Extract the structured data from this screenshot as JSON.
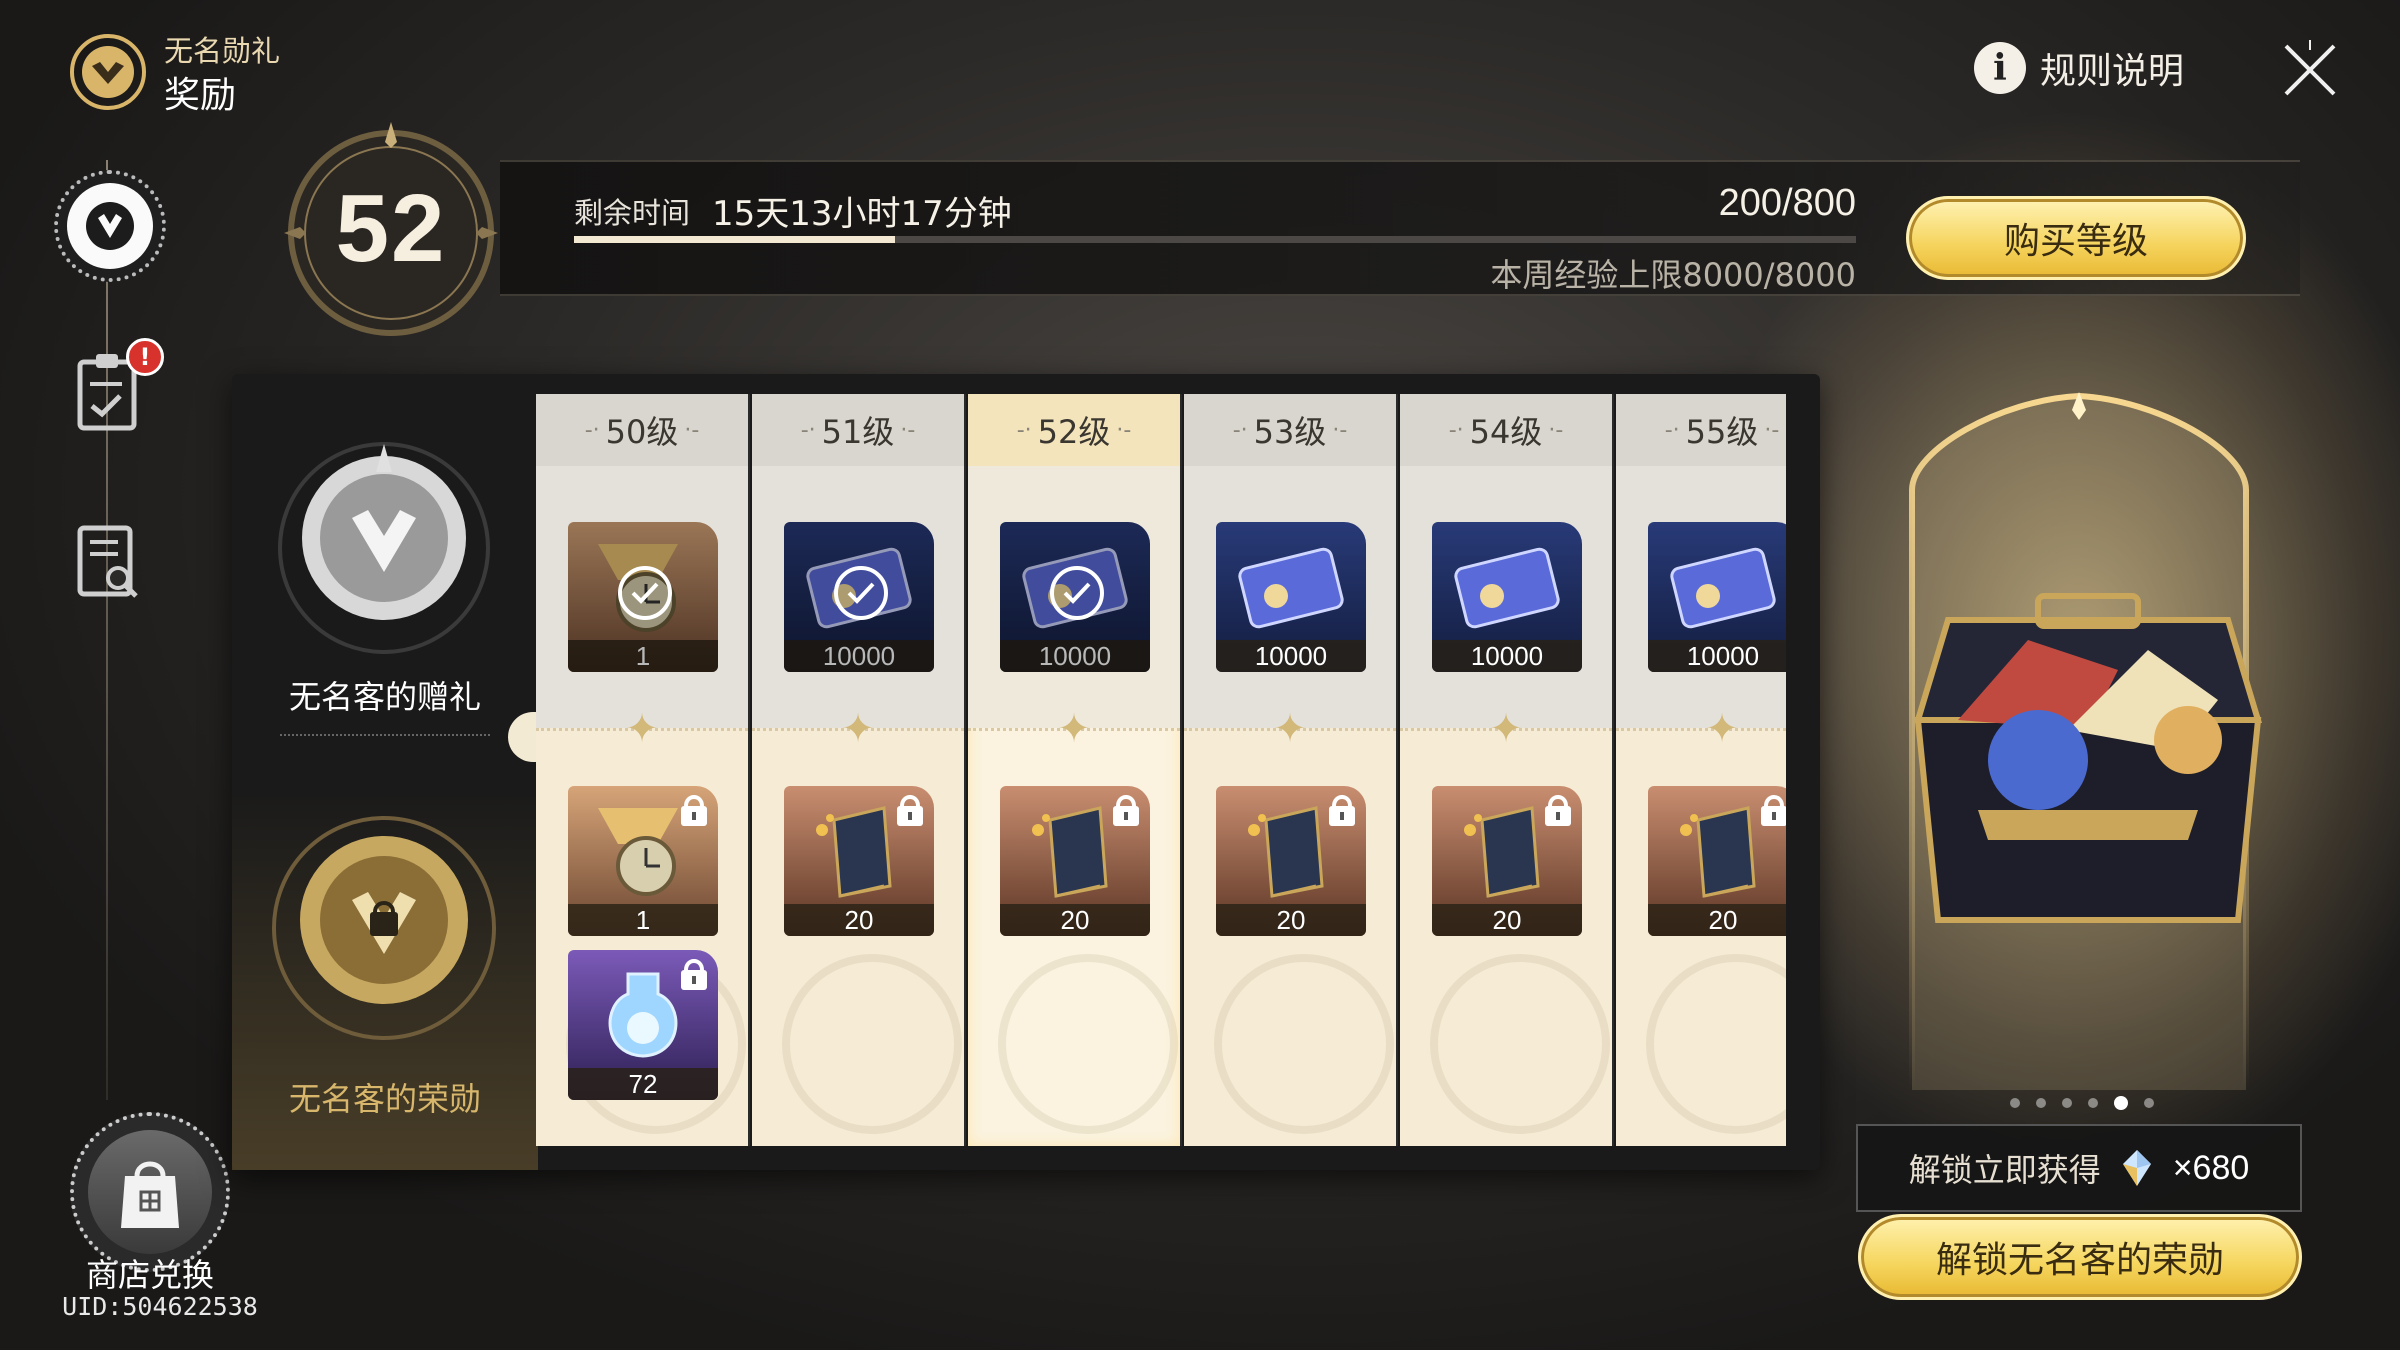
{
  "header": {
    "subtitle": "无名勋礼",
    "title": "奖励",
    "rules_label": "规则说明",
    "rules_icon": "info-icon",
    "close_icon": "close-icon"
  },
  "sidebar": {
    "alert_badge": "!",
    "shop_label": "商店兑换",
    "uid": "UID:504622538"
  },
  "level": {
    "current": "52",
    "time_label": "剩余时间",
    "time_value": "15天13小时17分钟",
    "xp": "200/800",
    "xp_progress": 0.25,
    "weekly_cap": "本周经验上限8000/8000",
    "buy_label": "购买等级"
  },
  "tracks": {
    "free_label": "无名客的赠礼",
    "paid_label": "无名客的荣勋"
  },
  "columns": [
    {
      "level": "50级",
      "free": {
        "type": "gold-watch",
        "qty": "1",
        "claimed": true
      },
      "paid": [
        {
          "type": "gold-watch",
          "qty": "1"
        },
        {
          "type": "potion",
          "qty": "72"
        }
      ]
    },
    {
      "level": "51级",
      "free": {
        "type": "credit-card",
        "qty": "10000",
        "claimed": true
      },
      "paid": [
        {
          "type": "book",
          "qty": "20"
        }
      ]
    },
    {
      "level": "52级",
      "free": {
        "type": "credit-card",
        "qty": "10000",
        "claimed": true
      },
      "paid": [
        {
          "type": "book",
          "qty": "20"
        }
      ],
      "current": true
    },
    {
      "level": "53级",
      "free": {
        "type": "credit-card",
        "qty": "10000",
        "claimed": false
      },
      "paid": [
        {
          "type": "book",
          "qty": "20"
        }
      ]
    },
    {
      "level": "54级",
      "free": {
        "type": "credit-card",
        "qty": "10000",
        "claimed": false
      },
      "paid": [
        {
          "type": "book",
          "qty": "20"
        }
      ]
    },
    {
      "level": "55级",
      "free": {
        "type": "credit-card",
        "qty": "10000",
        "claimed": false
      },
      "paid": [
        {
          "type": "book",
          "qty": "20"
        }
      ]
    }
  ],
  "unlock": {
    "info_label": "解锁立即获得",
    "count": "×680",
    "button_label": "解锁无名客的荣勋",
    "carousel_total": 6,
    "carousel_active": 5
  },
  "colors": {
    "accent_gold": "#f5d35c",
    "paid_label": "#d8b66c",
    "alert": "#d8322c"
  }
}
